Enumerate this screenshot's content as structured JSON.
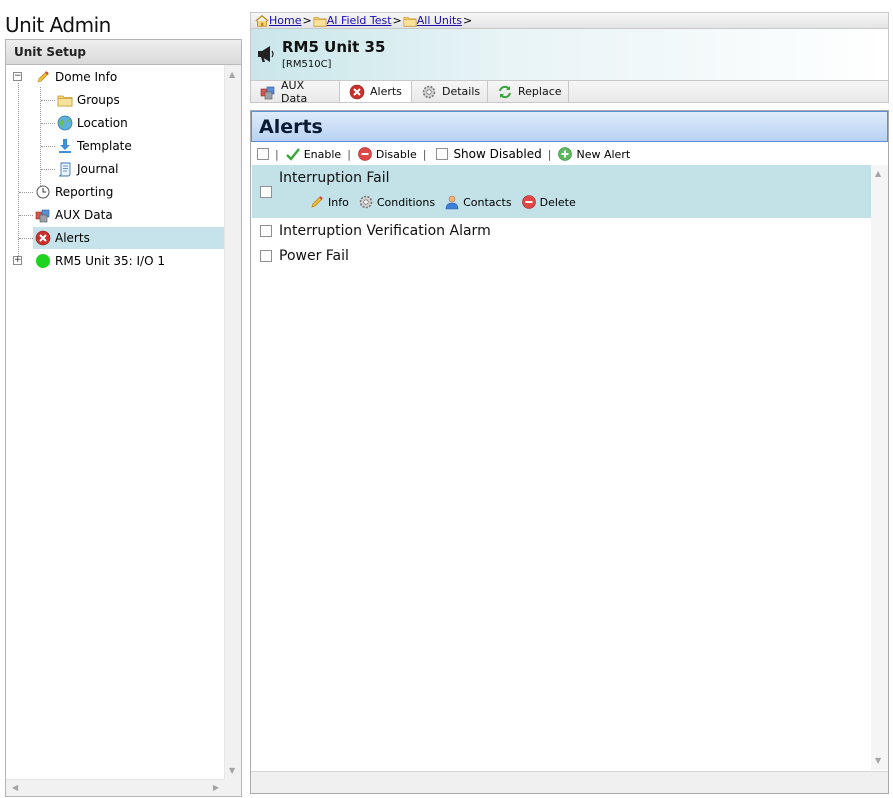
{
  "page": {
    "title": "Unit Admin"
  },
  "left_panel": {
    "header": "Unit Setup",
    "tree": {
      "dome_info": "Dome Info",
      "groups": "Groups",
      "location": "Location",
      "template": "Template",
      "journal": "Journal",
      "reporting": "Reporting",
      "aux_data": "AUX Data",
      "alerts": "Alerts",
      "io_unit": "RM5 Unit 35: I/O 1"
    }
  },
  "breadcrumb": {
    "home": "Home",
    "field_test": "AI Field Test",
    "all_units": "All Units",
    "separator": ">"
  },
  "unit": {
    "title": "RM5 Unit 35",
    "model": "[RM510C]"
  },
  "tabs": {
    "aux_data": "AUX Data",
    "alerts": "Alerts",
    "details": "Details",
    "replace": "Replace"
  },
  "alerts_panel": {
    "title": "Alerts",
    "toolbar": {
      "separator": "|",
      "enable": "Enable",
      "disable": "Disable",
      "show_disabled": "Show Disabled",
      "new_alert": "New Alert"
    },
    "items": [
      {
        "name": "Interruption Fail"
      },
      {
        "name": "Interruption Verification Alarm"
      },
      {
        "name": "Power Fail"
      }
    ],
    "row_actions": {
      "info": "Info",
      "conditions": "Conditions",
      "contacts": "Contacts",
      "delete": "Delete"
    }
  },
  "colors": {
    "selected_row": "#c6e2ea",
    "alerts_header": "#b8d2f3",
    "link": "#1a0dab"
  }
}
